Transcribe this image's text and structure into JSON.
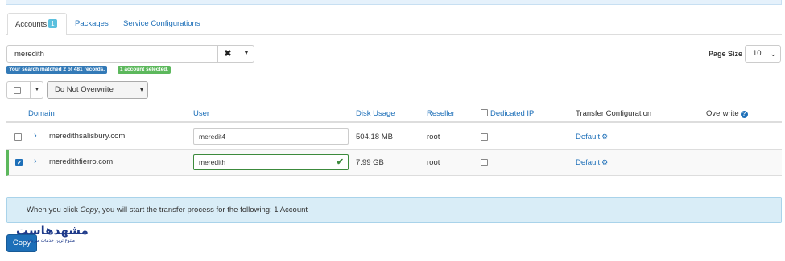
{
  "tabs": [
    {
      "label": "Accounts",
      "count": "1",
      "active": true
    },
    {
      "label": "Packages",
      "active": false
    },
    {
      "label": "Service Configurations",
      "active": false
    }
  ],
  "search": {
    "value": "meredith",
    "clear_icon": "close-icon",
    "caret_icon": "caret-down-icon"
  },
  "status": {
    "matched": "Your search matched 2 of 481 records.",
    "selected": "1 account selected."
  },
  "page_size": {
    "label": "Page Size",
    "value": "10"
  },
  "bulk": {
    "overwrite_option": "Do Not Overwrite"
  },
  "table": {
    "columns": {
      "domain": "Domain",
      "user": "User",
      "disk_usage": "Disk Usage",
      "reseller": "Reseller",
      "dedicated_ip": "Dedicated IP",
      "transfer_configuration": "Transfer Configuration",
      "overwrite": "Overwrite"
    },
    "rows": [
      {
        "domain": "meredithsalisbury.com",
        "user": "meredit4",
        "disk_usage": "504.18 MB",
        "reseller": "root",
        "transfer": "Default",
        "selected": false
      },
      {
        "domain": "meredithfierro.com",
        "user": "meredith",
        "disk_usage": "7.99 GB",
        "reseller": "root",
        "transfer": "Default",
        "selected": true
      }
    ]
  },
  "info": {
    "before": "When you click ",
    "emphasis": "Copy",
    "after": ", you will start the transfer process for the following: 1 Account"
  },
  "copy_button": "Copy",
  "watermark": {
    "brand": "مشهدهاست",
    "tagline": "متنوع ترین خدمات میزبانی"
  },
  "colors": {
    "link": "#1d6fb8",
    "success": "#5cb85c",
    "info_bg": "#d9edf7",
    "primary": "#1d6fb8"
  }
}
